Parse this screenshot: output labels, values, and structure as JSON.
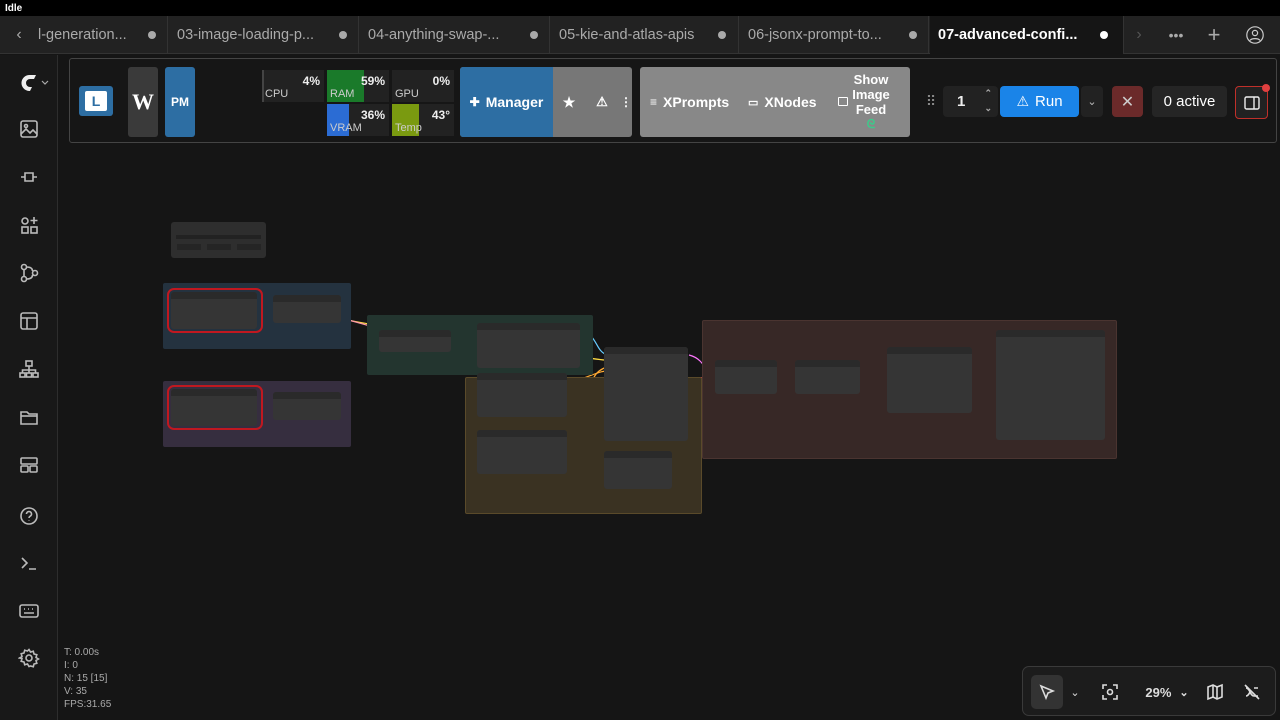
{
  "window": {
    "title": "Idle"
  },
  "tabs": [
    {
      "label": "l-generation..."
    },
    {
      "label": "03-image-loading-p..."
    },
    {
      "label": "04-anything-swap-..."
    },
    {
      "label": "05-kie-and-atlas-apis"
    },
    {
      "label": "06-jsonx-prompt-to..."
    },
    {
      "label": "07-advanced-confi...",
      "active": true
    }
  ],
  "toolbar": {
    "l_btn": "L",
    "w_btn": "W",
    "pm_btn": "PM",
    "stats": [
      {
        "label": "CPU",
        "value": "4%",
        "fraction": 0.04
      },
      {
        "label": "RAM",
        "value": "59%",
        "fraction": 0.59,
        "color": "#1a7a2a"
      },
      {
        "label": "GPU",
        "value": "0%",
        "fraction": 0.0
      },
      {
        "label": "VRAM",
        "value": "36%",
        "fraction": 0.36,
        "color": "#2b6cd4"
      },
      {
        "label": "Temp",
        "value": "43°",
        "fraction": 0.43,
        "color": "#7a9a10"
      }
    ],
    "manager_label": "Manager",
    "xprompts_label": "XPrompts",
    "xnodes_label": "XNodes",
    "image_feed_label_1": "Show",
    "image_feed_label_2": "Image",
    "image_feed_label_3": "Feed",
    "queue_count": "1",
    "run_label": "Run",
    "active_label": "0 active"
  },
  "canvas_stats": {
    "t": "T: 0.00s",
    "i": "I: 0",
    "n": "N: 15 [15]",
    "v": "V: 35",
    "fps": "FPS:31.65"
  },
  "bottom_controls": {
    "zoom": "29%"
  },
  "colors": {
    "accent": "#1a84e8",
    "manager": "#2d6ea3",
    "cancel": "#6b2a2a"
  }
}
